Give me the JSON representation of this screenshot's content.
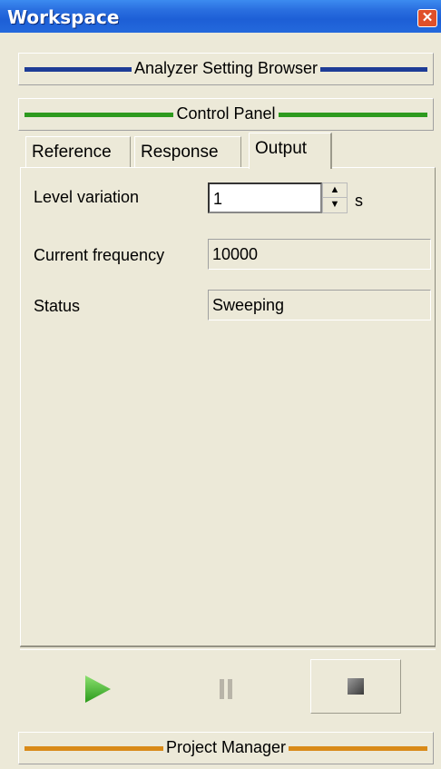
{
  "window": {
    "title": "Workspace"
  },
  "bars": [
    {
      "label": "Analyzer Setting Browser",
      "color": "#1e3c96"
    },
    {
      "label": "Control Panel",
      "color": "#2e9a1e"
    },
    {
      "label": "Project Manager",
      "color": "#d98a18"
    }
  ],
  "tabs": [
    {
      "label": "Reference"
    },
    {
      "label": "Response"
    },
    {
      "label": "Output",
      "active": true
    }
  ],
  "fields": {
    "level_variation": {
      "label": "Level variation",
      "value": "1",
      "unit": "s"
    },
    "current_frequency": {
      "label": "Current frequency",
      "value": "10000"
    },
    "status": {
      "label": "Status",
      "value": "Sweeping"
    }
  },
  "controls": {
    "play": {
      "icon": "play-icon",
      "color": "#3cb428"
    },
    "pause": {
      "icon": "pause-icon"
    },
    "stop": {
      "icon": "stop-icon"
    }
  }
}
